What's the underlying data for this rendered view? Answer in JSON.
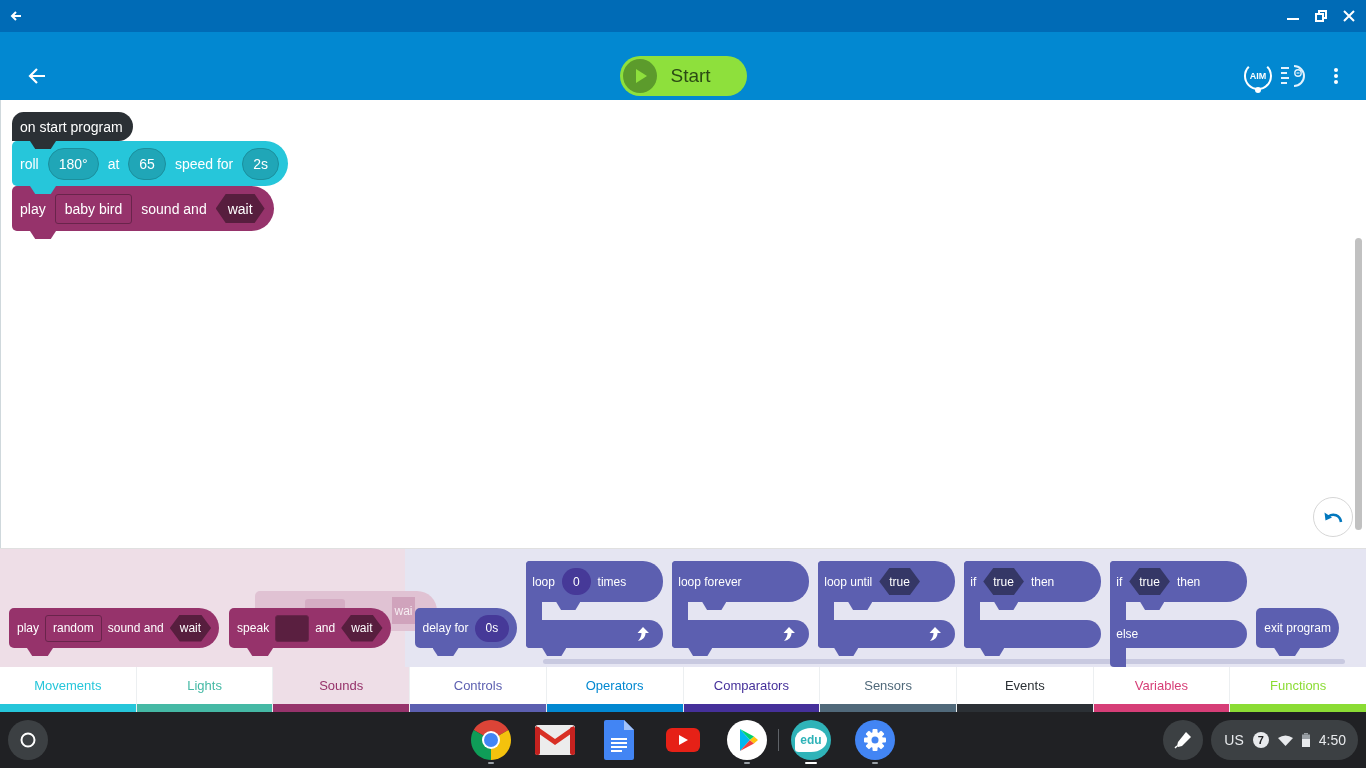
{
  "app_bar": {
    "start_button": {
      "label": "Start"
    },
    "aim_button": {
      "label": "AIM"
    }
  },
  "canvas": {
    "blocks": [
      {
        "kind": "hat",
        "color": "#2b3035",
        "parts": [
          {
            "kind": "text",
            "text": "on start program"
          }
        ]
      },
      {
        "kind": "stack",
        "color": "#26c6da",
        "parts": [
          {
            "kind": "text",
            "text": "roll"
          },
          {
            "kind": "oval",
            "text": "180°"
          },
          {
            "kind": "text",
            "text": "at"
          },
          {
            "kind": "oval",
            "text": "65"
          },
          {
            "kind": "text",
            "text": "speed for"
          },
          {
            "kind": "oval",
            "text": "2s"
          }
        ]
      },
      {
        "kind": "stack",
        "color": "#96336b",
        "parts": [
          {
            "kind": "text",
            "text": "play"
          },
          {
            "kind": "box",
            "text": "baby bird"
          },
          {
            "kind": "text",
            "text": "sound and"
          },
          {
            "kind": "hex",
            "text": "wait"
          }
        ]
      }
    ]
  },
  "palette": {
    "sections": [
      {
        "color": "#96336b",
        "blocks": [
          {
            "kind": "stack",
            "parts": [
              {
                "kind": "text",
                "text": "play"
              },
              {
                "kind": "box",
                "text": "random"
              },
              {
                "kind": "text",
                "text": "sound and"
              },
              {
                "kind": "hex",
                "text": "wait"
              }
            ]
          },
          {
            "kind": "stack",
            "parts": [
              {
                "kind": "text",
                "text": "speak"
              },
              {
                "kind": "box"
              },
              {
                "kind": "text",
                "text": "and"
              },
              {
                "kind": "hex",
                "text": "wait"
              }
            ]
          }
        ],
        "drag_preview": {
          "parts": [
            {
              "kind": "box"
            },
            {
              "kind": "hex",
              "text": "wai"
            }
          ]
        }
      },
      {
        "color": "#5c5fb0",
        "blocks": [
          {
            "kind": "stack",
            "parts": [
              {
                "kind": "text",
                "text": "delay for"
              },
              {
                "kind": "oval",
                "text": "0s"
              }
            ]
          },
          {
            "kind": "loop",
            "parts": [
              {
                "kind": "text",
                "text": "loop"
              },
              {
                "kind": "oval",
                "text": "0"
              },
              {
                "kind": "text",
                "text": "times"
              }
            ]
          },
          {
            "kind": "loop",
            "parts": [
              {
                "kind": "text",
                "text": "loop forever"
              }
            ]
          },
          {
            "kind": "loop",
            "parts": [
              {
                "kind": "text",
                "text": "loop until"
              },
              {
                "kind": "hex",
                "text": "true"
              }
            ]
          },
          {
            "kind": "if",
            "parts": [
              {
                "kind": "text",
                "text": "if"
              },
              {
                "kind": "hex",
                "text": "true"
              },
              {
                "kind": "text",
                "text": "then"
              }
            ]
          },
          {
            "kind": "if_else",
            "parts": [
              {
                "kind": "text",
                "text": "if"
              },
              {
                "kind": "hex",
                "text": "true"
              },
              {
                "kind": "text",
                "text": "then"
              }
            ],
            "else_label": "else"
          },
          {
            "kind": "stack",
            "parts": [
              {
                "kind": "text",
                "text": "exit program"
              }
            ]
          }
        ]
      }
    ]
  },
  "categories": [
    {
      "label": "Movements",
      "color": "#26c6da",
      "selected": false
    },
    {
      "label": "Lights",
      "color": "#45b9a5",
      "selected": false
    },
    {
      "label": "Sounds",
      "color": "#96336b",
      "selected": true
    },
    {
      "label": "Controls",
      "color": "#5c5fb0",
      "selected": false
    },
    {
      "label": "Operators",
      "color": "#0288d1",
      "selected": false
    },
    {
      "label": "Comparators",
      "color": "#45309a",
      "selected": false
    },
    {
      "label": "Sensors",
      "color": "#50697a",
      "selected": false
    },
    {
      "label": "Events",
      "color": "#2b3035",
      "selected": false
    },
    {
      "label": "Variables",
      "color": "#d63e77",
      "selected": false
    },
    {
      "label": "Functions",
      "color": "#8bdc34",
      "selected": false
    }
  ],
  "shelf": {
    "pinned_apps": [
      {
        "kind": "browser",
        "running": true,
        "active": false
      },
      {
        "kind": "mail",
        "running": false,
        "active": false
      },
      {
        "kind": "docs",
        "running": false,
        "active": false
      },
      {
        "kind": "video",
        "running": false,
        "active": false
      },
      {
        "kind": "store",
        "running": true,
        "active": false
      }
    ],
    "other_apps": [
      {
        "kind": "edu",
        "label": "edu",
        "running": true,
        "active": true
      },
      {
        "kind": "settings",
        "running": true,
        "active": false
      }
    ],
    "status": {
      "keyboard": "US",
      "notifications": "7",
      "time": "4:50"
    }
  }
}
